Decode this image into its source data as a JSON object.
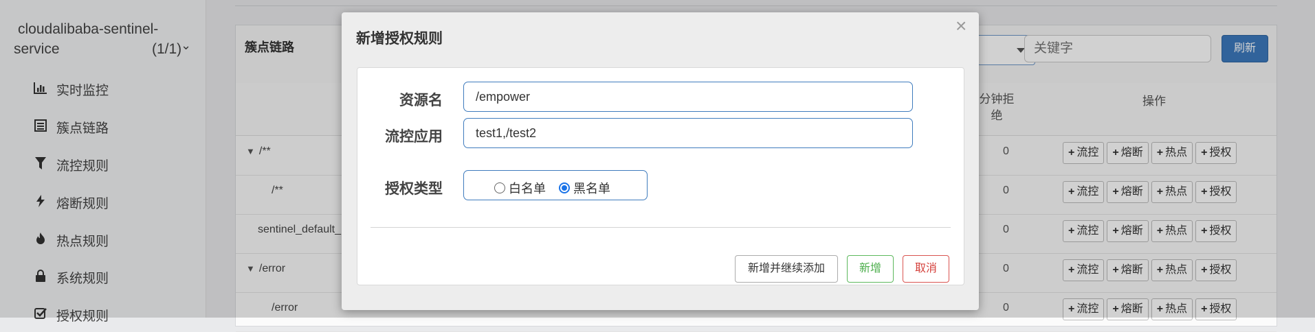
{
  "sidebar": {
    "app_name_line1": "cloudalibaba-sentinel-",
    "app_name_line2": "service",
    "app_count": "(1/1)",
    "chevron_glyph": "⌄",
    "items": [
      {
        "label": "实时监控",
        "icon": "bar-chart-icon",
        "glyph": "📊"
      },
      {
        "label": "簇点链路",
        "icon": "list-icon",
        "glyph": "☰"
      },
      {
        "label": "流控规则",
        "icon": "filter-icon",
        "glyph": "▼"
      },
      {
        "label": "熔断规则",
        "icon": "bolt-icon",
        "glyph": "⚡"
      },
      {
        "label": "热点规则",
        "icon": "fire-icon",
        "glyph": "♨"
      },
      {
        "label": "系统规则",
        "icon": "lock-icon",
        "glyph": "🔒"
      },
      {
        "label": "授权规则",
        "icon": "check-square-icon",
        "glyph": "☑"
      }
    ]
  },
  "panel": {
    "title": "簇点链路",
    "search_placeholder": "关键字",
    "refresh_label": "刷新",
    "col_reject": "分钟拒绝",
    "col_ops": "操作",
    "rows": [
      {
        "name": "/**",
        "expandable": true,
        "value": "0"
      },
      {
        "name": "/**",
        "expandable": false,
        "value": "0"
      },
      {
        "name": "sentinel_default_",
        "expandable": false,
        "value": "0"
      },
      {
        "name": "/error",
        "expandable": true,
        "value": "0"
      },
      {
        "name": "/error",
        "expandable": false,
        "value": "0"
      }
    ],
    "op_buttons": [
      "流控",
      "熔断",
      "热点",
      "授权"
    ]
  },
  "modal": {
    "title": "新增授权规则",
    "close_glyph": "×",
    "resource_label": "资源名",
    "resource_value": "/empower",
    "app_label": "流控应用",
    "app_value": "test1,/test2",
    "type_label": "授权类型",
    "type_options": [
      {
        "label": "白名单",
        "checked": false
      },
      {
        "label": "黑名单",
        "checked": true
      }
    ],
    "btn_add_continue": "新增并继续添加",
    "btn_add": "新增",
    "btn_cancel": "取消"
  },
  "colors": {
    "primary": "#3c79bd",
    "success": "#5cb85c",
    "danger": "#d9534f",
    "radio_checked": "#1a73e8"
  }
}
